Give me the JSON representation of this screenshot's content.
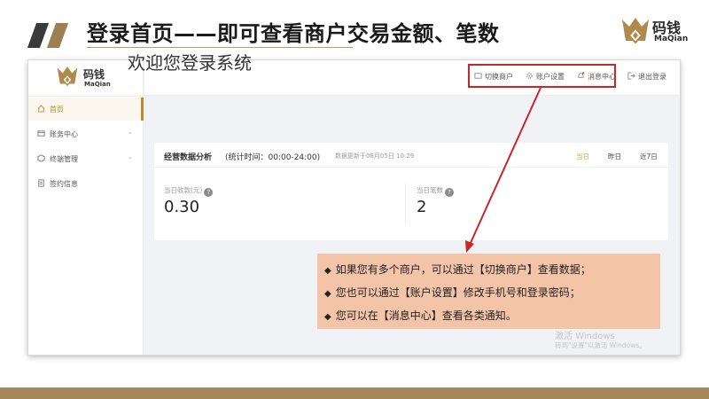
{
  "slide": {
    "title": "登录首页——即可查看商户交易金额、笔数",
    "brand_cn": "码钱",
    "brand_en": "MaQian"
  },
  "app": {
    "logo_cn": "码钱",
    "logo_en": "MaQian",
    "sidebar": {
      "items": [
        {
          "label": "首页",
          "icon": "home-icon",
          "active": true
        },
        {
          "label": "账务中心",
          "icon": "finance-icon",
          "expandable": true
        },
        {
          "label": "终端管理",
          "icon": "terminal-icon",
          "expandable": true
        },
        {
          "label": "签约信息",
          "icon": "contract-icon"
        }
      ]
    },
    "topbar": {
      "switch_merchant": "切换商户",
      "account_settings": "账户设置",
      "message_center": "消息中心",
      "logout": "退出登录"
    },
    "welcome": "欢迎您登录系统",
    "card": {
      "title": "经营数据分析",
      "time_range": "(统计时间：00:00-24:00)",
      "updated": "数据更新于08月05日 10:29",
      "periods": [
        "当日",
        "昨日",
        "近7日"
      ],
      "active_period": "当日",
      "stats": [
        {
          "label": "当日收款(元)",
          "value": "0.30"
        },
        {
          "label": "当日笔数",
          "value": "2"
        }
      ]
    },
    "watermark": {
      "line1": "激活 Windows",
      "line2": "转到\"设置\"以激活 Windows。"
    }
  },
  "callout": {
    "bullet": "◆",
    "lines": [
      "如果您有多个商户，可以通过【切换商户】查看数据；",
      "您也可以通过【账户设置】修改手机号和登录密码；",
      "您可以在【消息中心】查看各类通知。"
    ]
  },
  "colors": {
    "accent_gold": "#c28a2c",
    "brand_brown": "#a8875a",
    "highlight_red": "#c8262b",
    "callout_bg": "#f3c4a8"
  }
}
